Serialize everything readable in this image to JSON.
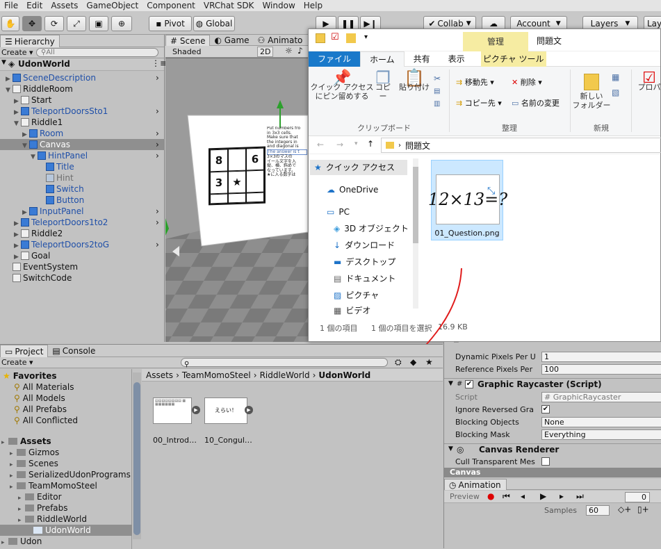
{
  "menu": [
    "File",
    "Edit",
    "Assets",
    "GameObject",
    "Component",
    "VRChat SDK",
    "Window",
    "Help"
  ],
  "toolbar": {
    "pivot": "Pivot",
    "global": "Global",
    "collab": "Collab",
    "account": "Account",
    "layers": "Layers",
    "layout": "Lay"
  },
  "hierarchy": {
    "tab": "Hierarchy",
    "create": "Create",
    "search_placeholder": "All",
    "scene_name": "UdonWorld",
    "items": [
      {
        "label": "SceneDescription",
        "style": "prefab",
        "indent": 1,
        "arrow": "▶"
      },
      {
        "label": "RiddleRoom",
        "style": "normal",
        "indent": 1,
        "arrow": "▼"
      },
      {
        "label": "Start",
        "style": "normal",
        "indent": 2,
        "arrow": "▶"
      },
      {
        "label": "TeleportDoorsSto1",
        "style": "prefab",
        "indent": 2,
        "arrow": "▶"
      },
      {
        "label": "Riddle1",
        "style": "normal",
        "indent": 2,
        "arrow": "▼"
      },
      {
        "label": "Room",
        "style": "prefab",
        "indent": 3,
        "arrow": "▶"
      },
      {
        "label": "Canvas",
        "style": "prefab",
        "indent": 3,
        "arrow": "▼",
        "selected": true
      },
      {
        "label": "HintPanel",
        "style": "prefab",
        "indent": 4,
        "arrow": "▼"
      },
      {
        "label": "Title",
        "style": "prefab",
        "indent": 5,
        "arrow": ""
      },
      {
        "label": "Hint",
        "style": "disabled",
        "indent": 5,
        "arrow": ""
      },
      {
        "label": "Switch",
        "style": "prefab",
        "indent": 5,
        "arrow": ""
      },
      {
        "label": "Button",
        "style": "prefab",
        "indent": 5,
        "arrow": ""
      },
      {
        "label": "InputPanel",
        "style": "prefab",
        "indent": 3,
        "arrow": "▶"
      },
      {
        "label": "TeleportDoors1to2",
        "style": "prefab",
        "indent": 2,
        "arrow": "▶"
      },
      {
        "label": "Riddle2",
        "style": "normal",
        "indent": 2,
        "arrow": "▶"
      },
      {
        "label": "TeleportDoors2toG",
        "style": "prefab",
        "indent": 2,
        "arrow": "▶"
      },
      {
        "label": "Goal",
        "style": "normal",
        "indent": 2,
        "arrow": "▶"
      },
      {
        "label": "EventSystem",
        "style": "normal",
        "indent": 1,
        "arrow": ""
      },
      {
        "label": "SwitchCode",
        "style": "normal",
        "indent": 1,
        "arrow": ""
      }
    ]
  },
  "scene": {
    "tabs": [
      "Scene",
      "Game",
      "Animato"
    ],
    "shading": "Shaded",
    "mode2d": "2D",
    "grid": [
      "8",
      "",
      "6",
      "3",
      "★",
      "",
      "",
      "",
      ""
    ],
    "text_lines": [
      "Put numbers fro",
      "in 3x3 cells.",
      "Make sure that",
      "the integers in",
      "and diagonal is",
      "The answer is t",
      "3×3のマスの",
      "イール文字を入",
      "縦、横、斜めで",
      "なっています。",
      "★に入る数字は"
    ]
  },
  "explorer": {
    "title": "問題文",
    "manage_tab": "管理",
    "tabs": [
      "ファイル",
      "ホーム",
      "共有",
      "表示",
      "ピクチャ ツール"
    ],
    "ribbon": {
      "pin": "クイック アクセス\nにピン留めする",
      "copy": "コピー",
      "paste": "貼り付け",
      "group_clipboard": "クリップボード",
      "move_to": "移動先",
      "delete": "削除",
      "copy_to": "コピー先",
      "rename": "名前の変更",
      "group_organize": "整理",
      "new_folder": "新しい\nフォルダー",
      "group_new": "新規",
      "properties": "プロパ"
    },
    "path": "問題文",
    "nav": [
      "クイック アクセス",
      "OneDrive",
      "PC",
      "3D オブジェクト",
      "ダウンロード",
      "デスクトップ",
      "ドキュメント",
      "ピクチャ",
      "ビデオ"
    ],
    "file_name": "01_Question.png",
    "file_content": "12×13=?",
    "status_count": "1 個の項目",
    "status_selected": "1 個の項目を選択",
    "status_size": "16.9 KB"
  },
  "project": {
    "tabs": [
      "Project",
      "Console"
    ],
    "create": "Create",
    "favorites": [
      "Favorites",
      "All Materials",
      "All Models",
      "All Prefabs",
      "All Conflicted"
    ],
    "assets_tree": [
      {
        "label": "Assets",
        "indent": 0,
        "bold": true
      },
      {
        "label": "Gizmos",
        "indent": 1
      },
      {
        "label": "Scenes",
        "indent": 1
      },
      {
        "label": "SerializedUdonPrograms",
        "indent": 1
      },
      {
        "label": "TeamMomoSteel",
        "indent": 1
      },
      {
        "label": "Editor",
        "indent": 2
      },
      {
        "label": "Prefabs",
        "indent": 2
      },
      {
        "label": "RiddleWorld",
        "indent": 2
      },
      {
        "label": "UdonWorld",
        "indent": 3,
        "selected": true
      },
      {
        "label": "Udon",
        "indent": 0
      }
    ],
    "breadcrumb": [
      "Assets",
      "TeamMomoSteel",
      "RiddleWorld",
      "UdonWorld"
    ],
    "assets": [
      {
        "name": "00_Introd…",
        "thumb": "intro"
      },
      {
        "name": "10_Congul…",
        "thumb": "えらい！"
      }
    ]
  },
  "inspector": {
    "rows": [
      {
        "label": "Dynamic Pixels Per U",
        "value": "1"
      },
      {
        "label": "Reference Pixels Per",
        "value": "100"
      }
    ],
    "raycaster_title": "Graphic Raycaster (Script)",
    "script_label": "Script",
    "script_value": "GraphicRaycaster",
    "ignore_label": "Ignore Reversed Gra",
    "blocking_objects_label": "Blocking Objects",
    "blocking_objects_value": "None",
    "blocking_mask_label": "Blocking Mask",
    "blocking_mask_value": "Everything",
    "canvas_renderer_title": "Canvas Renderer",
    "cull_label": "Cull Transparent Mes",
    "canvas_footer": "Canvas",
    "animation_tab": "Animation",
    "preview": "Preview",
    "frame": "0",
    "samples_label": "Samples",
    "samples_value": "60"
  }
}
